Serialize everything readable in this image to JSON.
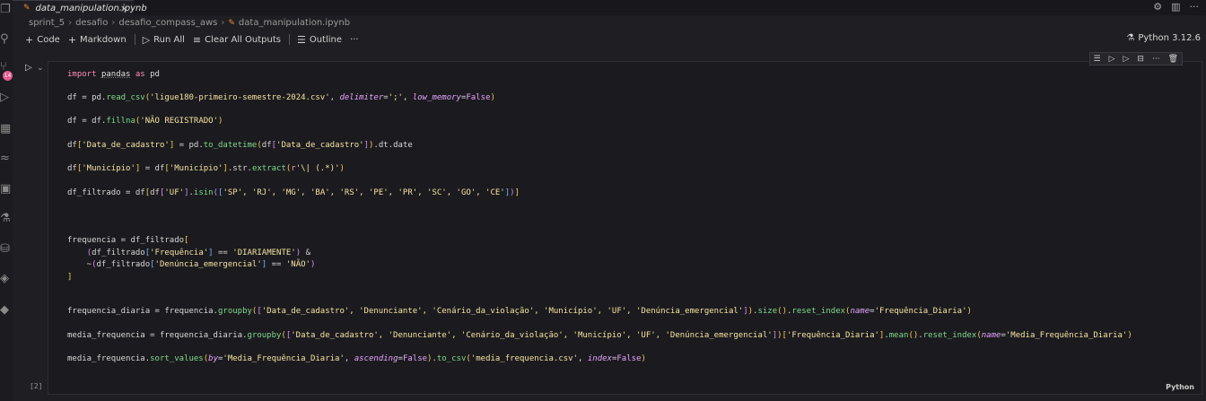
{
  "tab": {
    "label": "data_manipulation.ipynb"
  },
  "breadcrumb": [
    "sprint_5",
    "desafio",
    "desafio_compass_aws",
    "data_manipulation.ipynb"
  ],
  "toolbar": {
    "code": "Code",
    "markdown": "Markdown",
    "run_all": "Run All",
    "clear_all": "Clear All Outputs",
    "outline": "Outline",
    "more": "···"
  },
  "kernel": "Python 3.12.6",
  "activity": {
    "badge_count": "14"
  },
  "cell": {
    "execution_count": "[2]",
    "language": "Python"
  },
  "code": {
    "l1": {
      "a": "import ",
      "b": "pandas",
      "c": " as ",
      "d": "pd"
    },
    "l2": {
      "a": "df = pd.",
      "b": "read_csv",
      "c": "(",
      "d": "'ligue180-primeiro-semestre-2024.csv'",
      "e": ", ",
      "f": "delimiter",
      "g": "=",
      "h": "';'",
      "i": ", ",
      "j": "low_memory",
      "k": "=",
      "l": "False",
      "m": ")"
    },
    "l3": {
      "a": "df = df.",
      "b": "fillna",
      "c": "(",
      "d": "'NÃO REGISTRADO'",
      "e": ")"
    },
    "l4": {
      "a": "df",
      "b": "[",
      "c": "'Data_de_cadastro'",
      "d": "]",
      "e": " = pd.",
      "f": "to_datetime",
      "g": "(",
      "h": "df",
      "i": "[",
      "j": "'Data_de_cadastro'",
      "k": "]",
      "l": ")",
      "m": ".dt.date"
    },
    "l5": {
      "a": "df",
      "b": "[",
      "c": "'Município'",
      "d": "]",
      "e": " = df",
      "f": "[",
      "g": "'Município'",
      "h": "]",
      "i": ".str.",
      "j": "extract",
      "k": "(",
      "l": "r",
      "m": "'\\| (.*)'",
      "n": ")"
    },
    "l6": {
      "a": "df_filtrado = df",
      "b": "[",
      "c": "df",
      "d": "[",
      "e": "'UF'",
      "f": "]",
      "g": ".",
      "h": "isin",
      "i": "(",
      "j": "[",
      "k": "'SP', 'RJ', 'MG', 'BA', 'RS', 'PE', 'PR', 'SC', 'GO', 'CE'",
      "l": "]",
      "m": ")",
      "n": "]"
    },
    "l7": {
      "a": "frequencia = df_filtrado",
      "b": "["
    },
    "l8": {
      "a": "    ",
      "b": "(",
      "c": "df_filtrado",
      "d": "[",
      "e": "'Frequência'",
      "f": "]",
      "g": " == ",
      "h": "'DIARIAMENTE'",
      "i": ")",
      "j": " &"
    },
    "l9": {
      "a": "    ~",
      "b": "(",
      "c": "df_filtrado",
      "d": "[",
      "e": "'Denúncia_emergencial'",
      "f": "]",
      "g": " == ",
      "h": "'NÃO'",
      "i": ")"
    },
    "l10": {
      "a": "]"
    },
    "l11": {
      "a": "frequencia_diaria = frequencia.",
      "b": "groupby",
      "c": "(",
      "d": "[",
      "e": "'Data_de_cadastro', 'Denunciante', 'Cenário_da_violação', 'Município', 'UF', 'Denúncia_emergencial'",
      "f": "]",
      "g": ")",
      "h": ".",
      "i": "size",
      "j": "()",
      "k": ".",
      "l": "reset_index",
      "m": "(",
      "n": "name",
      "o": "=",
      "p": "'Frequência_Diaria'",
      "q": ")"
    },
    "l12": {
      "a": "media_frequencia = frequencia_diaria.",
      "b": "groupby",
      "c": "(",
      "d": "[",
      "e": "'Data_de_cadastro', 'Denunciante', 'Cenário_da_violação', 'Município', 'UF', 'Denúncia_emergencial'",
      "f": "]",
      "g": ")",
      "h": "[",
      "i": "'Frequência_Diaria'",
      "j": "]",
      "k": ".",
      "l": "mean",
      "m": "()",
      "n": ".",
      "o": "reset_index",
      "p": "(",
      "q": "name",
      "r": "=",
      "s": "'Media_Frequência_Diaria'",
      "t": ")"
    },
    "l13": {
      "a": "media_frequencia.",
      "b": "sort_values",
      "c": "(",
      "d": "by",
      "e": "=",
      "f": "'Media_Frequência_Diaria'",
      "g": ", ",
      "h": "ascending",
      "i": "=",
      "j": "False",
      "k": ")",
      "l": ".",
      "m": "to_csv",
      "n": "(",
      "o": "'media_frequencia.csv'",
      "p": ", ",
      "q": "index",
      "r": "=",
      "s": "False",
      "t": ")"
    }
  }
}
